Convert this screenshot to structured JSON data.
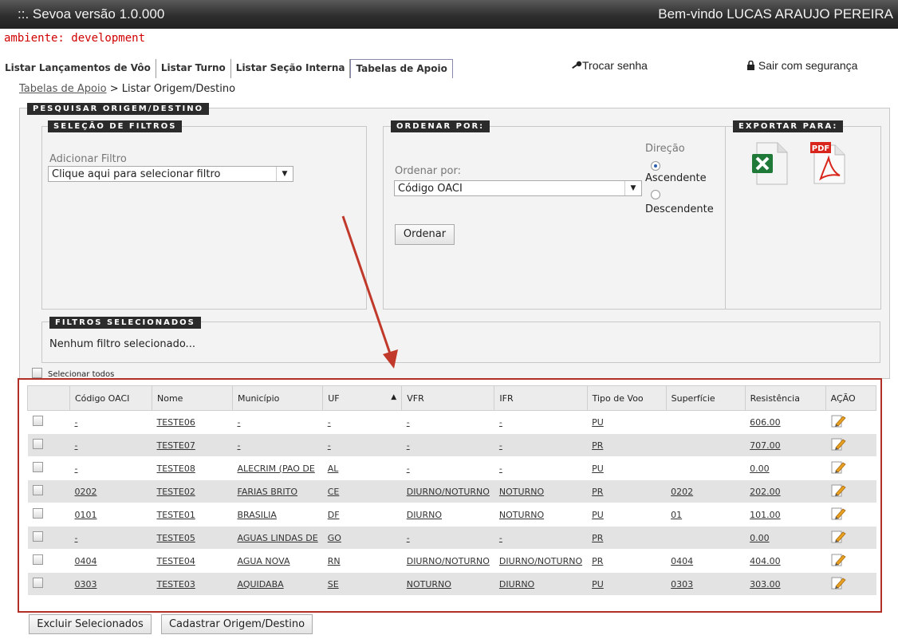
{
  "header": {
    "title": "::.  Sevoa versão 1.0.000",
    "welcome": "Bem-vindo LUCAS ARAUJO PEREIRA"
  },
  "environment": "ambiente: development",
  "nav": {
    "items": [
      {
        "label": "Listar Lançamentos de Vôo"
      },
      {
        "label": "Listar Turno"
      },
      {
        "label": "Listar Seção Interna"
      },
      {
        "label": "Tabelas de Apoio"
      }
    ],
    "change_password": "Trocar senha",
    "logout": "Sair com segurança"
  },
  "breadcrumb": {
    "parent": "Tabelas de Apoio",
    "separator": ">",
    "current": "Listar Origem/Destino"
  },
  "search": {
    "title": "PESQUISAR ORIGEM/DESTINO",
    "filters": {
      "title": "SELEÇÃO DE FILTROS",
      "add_label": "Adicionar Filtro",
      "select_value": "Clique aqui para selecionar filtro"
    },
    "order": {
      "title": "ORDENAR POR:",
      "label": "Ordenar por:",
      "select_value": "Código OACI",
      "direction_label": "Direção",
      "ascending": "Ascendente",
      "descending": "Descendente",
      "selected": "Ascendente",
      "button": "Ordenar"
    },
    "export": {
      "title": "EXPORTAR PARA:",
      "pdf_text": "PDF"
    },
    "selected_filters": {
      "title": "FILTROS SELECIONADOS",
      "empty": "Nenhum filtro selecionado..."
    }
  },
  "select_all": "Selecionar todos",
  "table": {
    "headers": [
      "Código OACI",
      "Nome",
      "Município",
      "UF",
      "VFR",
      "IFR",
      "Tipo de Voo",
      "Superfície",
      "Resistência",
      "AÇÃO"
    ],
    "rows": [
      [
        "-",
        "TESTE06",
        "-",
        "-",
        "-",
        "-",
        "PU",
        "",
        "606.00"
      ],
      [
        "-",
        "TESTE07",
        "-",
        "-",
        "-",
        "-",
        "PR",
        "",
        "707.00"
      ],
      [
        "-",
        "TESTE08",
        "ALECRIM (PAO DE",
        "AL",
        "-",
        "-",
        "PU",
        "",
        "0.00"
      ],
      [
        "0202",
        "TESTE02",
        "FARIAS BRITO",
        "CE",
        "DIURNO/NOTURNO",
        "NOTURNO",
        "PR",
        "0202",
        "202.00"
      ],
      [
        "0101",
        "TESTE01",
        "BRASILIA",
        "DF",
        "DIURNO",
        "NOTURNO",
        "PU",
        "01",
        "101.00"
      ],
      [
        "-",
        "TESTE05",
        "AGUAS LINDAS DE",
        "GO",
        "-",
        "-",
        "PR",
        "",
        "0.00"
      ],
      [
        "0404",
        "TESTE04",
        "AGUA NOVA",
        "RN",
        "DIURNO/NOTURNO",
        "DIURNO/NOTURNO",
        "PR",
        "0404",
        "404.00"
      ],
      [
        "0303",
        "TESTE03",
        "AQUIDABA",
        "SE",
        "NOTURNO",
        "DIURNO",
        "PU",
        "0303",
        "303.00"
      ]
    ]
  },
  "actions": {
    "delete": "Excluir Selecionados",
    "create": "Cadastrar Origem/Destino"
  },
  "colors": {
    "accent_red": "#c0392b",
    "env_red": "#d00000",
    "header_dark": "#2e2e2e"
  }
}
